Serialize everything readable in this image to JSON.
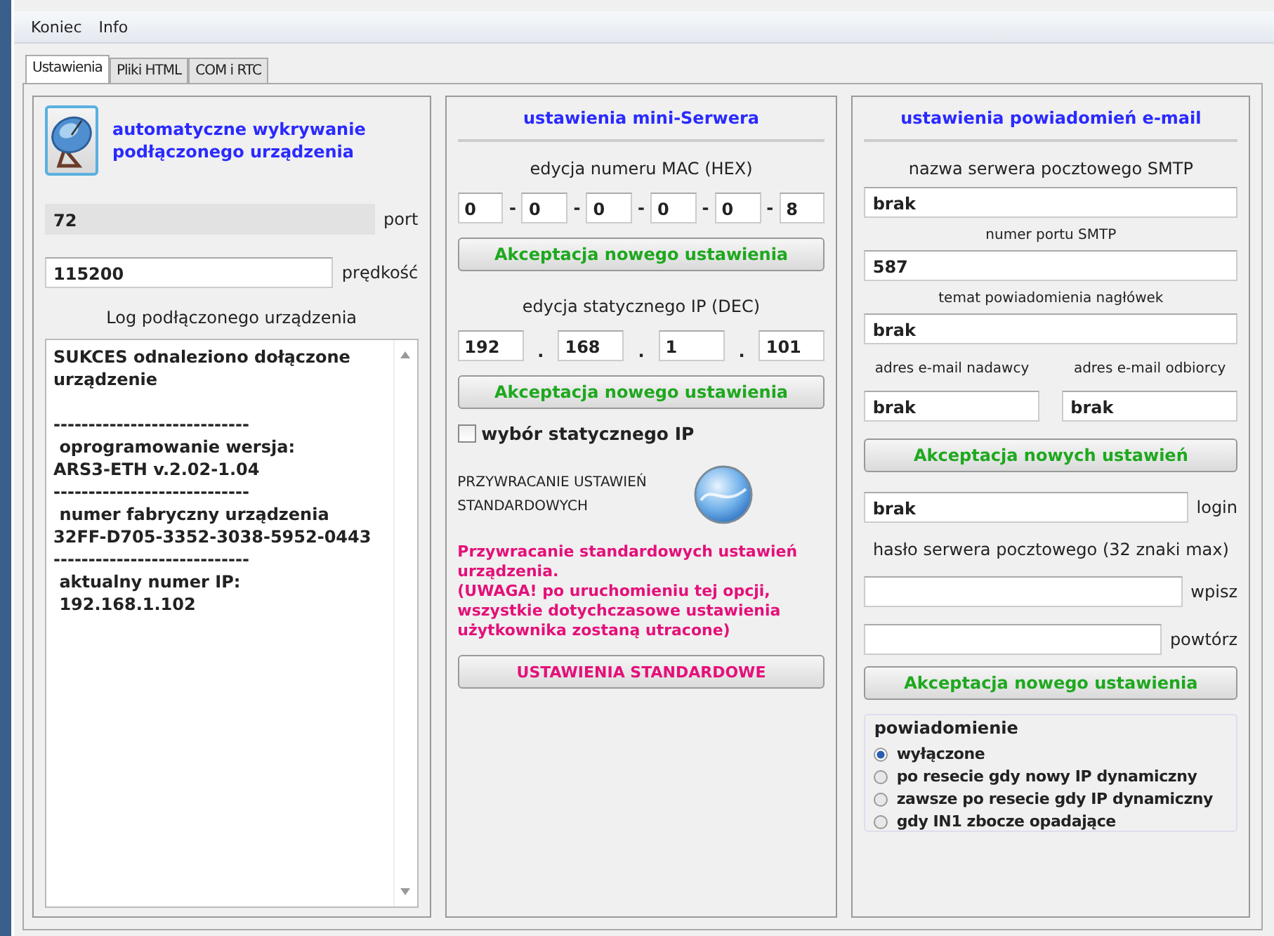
{
  "menu": [
    "Koniec",
    "Info"
  ],
  "tabs": [
    {
      "label": "Ustawienia",
      "selected": true
    },
    {
      "label": "Pliki HTML",
      "selected": false
    },
    {
      "label": "COM i RTC",
      "selected": false
    }
  ],
  "device": {
    "detect_label": "automatyczne wykrywanie podłączonego urządzenia",
    "port_value": "72",
    "port_label": "port",
    "speed_value": "115200",
    "speed_label": "prędkość",
    "log_title": "Log podłączonego urządzenia",
    "log_lines": [
      "SUKCES odnaleziono dołączone urządzenie",
      "----------------------------",
      " oprogramowanie wersja:",
      "ARS3-ETH v.2.02-1.04",
      "----------------------------",
      " numer fabryczny urządzenia",
      "32FF-D705-3352-3038-5952-0443",
      "----------------------------",
      " aktualny numer IP:",
      " 192.168.1.102"
    ]
  },
  "server": {
    "title": "ustawienia mini-Serwera",
    "mac_label": "edycja numeru MAC (HEX)",
    "mac": [
      "0",
      "0",
      "0",
      "0",
      "0",
      "8"
    ],
    "mac_sep": "-",
    "accept_mac": "Akceptacja nowego ustawienia",
    "ip_label": "edycja statycznego IP (DEC)",
    "ip": [
      "192",
      "168",
      "1",
      "101"
    ],
    "ip_sep": ".",
    "accept_ip": "Akceptacja nowego ustawienia",
    "static_ip": {
      "label": "wybór statycznego IP",
      "checked": false
    },
    "restore_label": "PRZYWRACANIE USTAWIEŃ STANDARDOWYCH",
    "warning": "Przywracanie standardowych ustawień urządzenia.\n(UWAGA! po uruchomieniu tej opcji, wszystkie dotychczasowe ustawienia użytkownika zostaną utracone)",
    "restore_button": "USTAWIENIA STANDARDOWE"
  },
  "email": {
    "title": "ustawienia powiadomień e-mail",
    "smtp_label": "nazwa serwera pocztowego SMTP",
    "smtp_value": "brak",
    "port_label": "numer portu SMTP",
    "port_value": "587",
    "subject_label": "temat powiadomienia nagłówek",
    "subject_value": "brak",
    "sender_label": "adres e-mail nadawcy",
    "recipient_label": "adres e-mail odbiorcy",
    "sender_value": "brak",
    "recipient_value": "brak",
    "accept": "Akceptacja nowych ustawień",
    "login_value": "brak",
    "login_label": "login",
    "password_label": "hasło serwera pocztowego (32 znaki max)",
    "enter_label": "wpisz",
    "repeat_label": "powtórz",
    "accept_password": "Akceptacja nowego ustawienia",
    "notify_title": "powiadomienie",
    "notify_options": [
      {
        "label": "wyłączone",
        "selected": true
      },
      {
        "label": "po resecie gdy nowy IP dynamiczny",
        "selected": false
      },
      {
        "label": "zawsze po resecie gdy IP dynamiczny",
        "selected": false
      },
      {
        "label": "gdy IN1 zbocze opadające",
        "selected": false
      }
    ]
  }
}
